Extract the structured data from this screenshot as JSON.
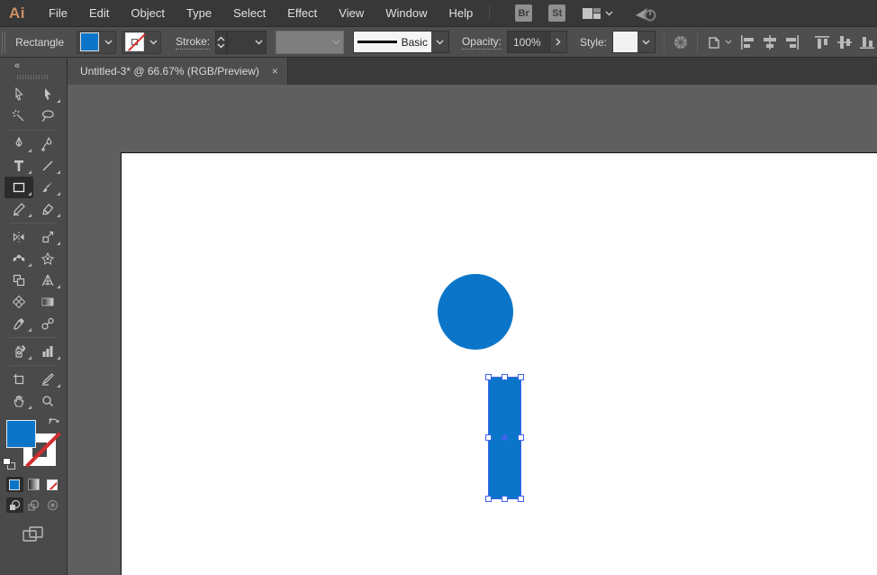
{
  "menubar": {
    "logo": "Ai",
    "items": [
      "File",
      "Edit",
      "Object",
      "Type",
      "Select",
      "Effect",
      "View",
      "Window",
      "Help"
    ],
    "bridge_label": "Br",
    "stock_label": "St",
    "icons": [
      "workspace-switcher-icon",
      "share-icon"
    ]
  },
  "controlbar": {
    "context_label": "Rectangle",
    "fill_color": "#0b76c9",
    "stroke_label": "Stroke:",
    "stroke_width_value": "",
    "brush_value": "",
    "stroke_style_value": "Basic",
    "opacity_label": "Opacity:",
    "opacity_value": "100%",
    "style_label": "Style:",
    "icons": [
      "globe-icon",
      "document-setup-icon",
      "align-left-icon",
      "align-center-h-icon",
      "align-right-icon",
      "align-top-icon",
      "align-middle-v-icon",
      "align-bottom-icon"
    ]
  },
  "tabbar": {
    "collapse_glyph": "«",
    "title": "Untitled-3* @ 66.67% (RGB/Preview)",
    "close_glyph": "×"
  },
  "toolbar": {
    "tools": [
      "selection",
      "direct-selection",
      "magic-wand",
      "lasso",
      "pen",
      "curvature",
      "type",
      "line-segment",
      "rectangle",
      "paintbrush",
      "shaper",
      "eraser",
      "reflect",
      "scale",
      "width",
      "puppet-warp",
      "shape-builder",
      "perspective-grid",
      "mesh",
      "gradient",
      "eyedropper",
      "blend",
      "symbol-sprayer",
      "column-graph",
      "artboard",
      "slice",
      "hand",
      "zoom"
    ],
    "selected_tool": "rectangle",
    "fill_proxy_color": "#0b76c9",
    "stroke_proxy": "none"
  },
  "canvas": {
    "background": "#5f5f5f",
    "artboard_color": "#ffffff",
    "shapes": {
      "donut": {
        "fill": "#0b76c9",
        "outer_diameter": 148,
        "inner_diameter": 64
      },
      "rectangle": {
        "fill": "#0b76c9",
        "width": 37,
        "height": 136,
        "selected": true
      }
    },
    "selection_color": "#3f63ec"
  }
}
